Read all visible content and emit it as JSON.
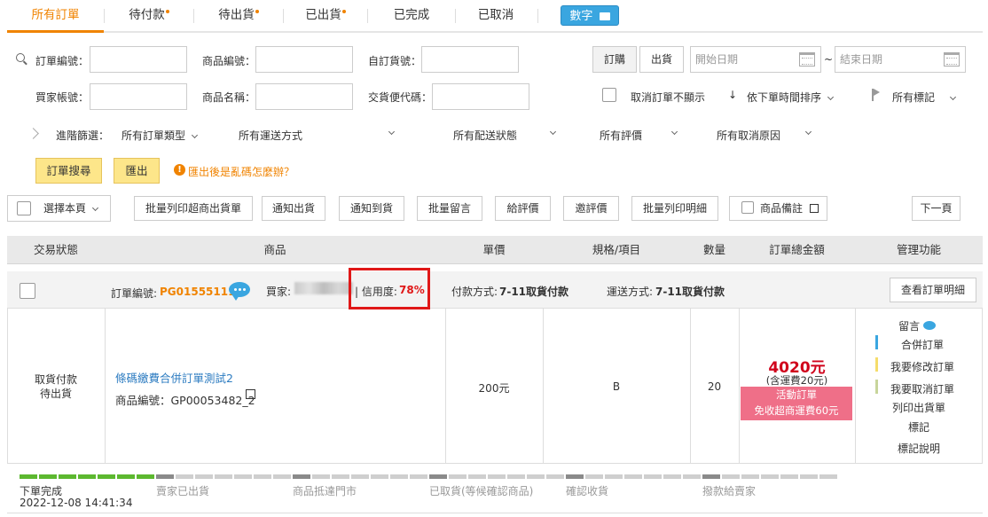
{
  "tabs": [
    {
      "label": "所有訂單",
      "dot": false
    },
    {
      "label": "待付款",
      "dot": true
    },
    {
      "label": "待出貨",
      "dot": true
    },
    {
      "label": "已出貨",
      "dot": true
    },
    {
      "label": "已完成",
      "dot": false
    },
    {
      "label": "已取消",
      "dot": false
    }
  ],
  "digital_button": "數字",
  "filters": {
    "order_no_label": "訂單編號：",
    "product_no_label": "商品編號：",
    "custom_ship_no_label": "自訂貨號：",
    "buyer_account_label": "買家帳號：",
    "product_name_label": "商品名稱：",
    "payment_code_label": "交貨便代碼：",
    "order_button": "訂購",
    "ship_button": "出貨",
    "start_date_placeholder": "開始日期",
    "date_separator": "~",
    "end_date_placeholder": "結束日期",
    "hide_cancelled_label": "取消訂單不顯示",
    "sort_label": "依下單時間排序",
    "all_marks_label": "所有標記",
    "advanced_label": "進階篩選：",
    "order_type": "所有訂單類型",
    "delivery": "所有運送方式",
    "delivery_status": "所有配送狀態",
    "rating": "所有評價",
    "cancel_reason": "所有取消原因",
    "search_button": "訂單搜尋",
    "export_button": "匯出",
    "export_help": "匯出後是亂碼怎麼辦？"
  },
  "actions": {
    "select_page": "選擇本頁",
    "batch_print_convenience": "批量列印超商出貨單",
    "notify_ship": "通知出貨",
    "notify_arrive": "通知到貨",
    "batch_message": "批量留言",
    "give_rating": "給評價",
    "invite_rating": "邀評價",
    "batch_print_detail": "批量列印明細",
    "product_note": "商品備註",
    "next_page": "下一頁"
  },
  "columns": {
    "status": "交易狀態",
    "product": "商品",
    "unit_price": "單價",
    "spec": "規格/項目",
    "qty": "數量",
    "total": "訂單總金額",
    "manage": "管理功能"
  },
  "order": {
    "order_no_label": "訂單編號:",
    "order_no": "PG01555111",
    "buyer_label": "買家:",
    "credit_label": "| 信用度:",
    "credit_value": "78%",
    "payment_label": "付款方式:",
    "payment_value": "7-11取貨付款",
    "delivery_label": "運送方式:",
    "delivery_value": "7-11取貨付款",
    "view_detail": "查看訂單明細",
    "status_line1": "取貨付款",
    "status_line2": "待出貨",
    "product_name": "條碼繳費合併訂單測試2",
    "product_code": "商品編號：GP00053482_2",
    "unit_price": "200元",
    "spec": "B",
    "qty": "20",
    "total": "4020元",
    "shipping_note": "(含運費20元)",
    "promo_line1": "活動訂單",
    "promo_line2": "免收超商運費60元",
    "manage": {
      "message": "留言",
      "merge": "合併訂單",
      "modify": "我要修改訂單",
      "cancel": "我要取消訂單",
      "print_ship": "列印出貨單",
      "mark": "標記",
      "mark_help": "標記說明"
    }
  },
  "progress": {
    "steps": [
      "下單完成",
      "賣家已出貨",
      "商品抵達門市",
      "已取貨(等候確認商品)",
      "確認收貨",
      "撥款給賣家"
    ],
    "timestamp": "2022-12-08 14:41:34",
    "completed_steps": 1
  },
  "colors": {
    "accent": "#f08300",
    "blue": "#3aa6e0",
    "red": "#e01818",
    "promo": "#ef6f88",
    "progress_done": "#5cb82f"
  }
}
